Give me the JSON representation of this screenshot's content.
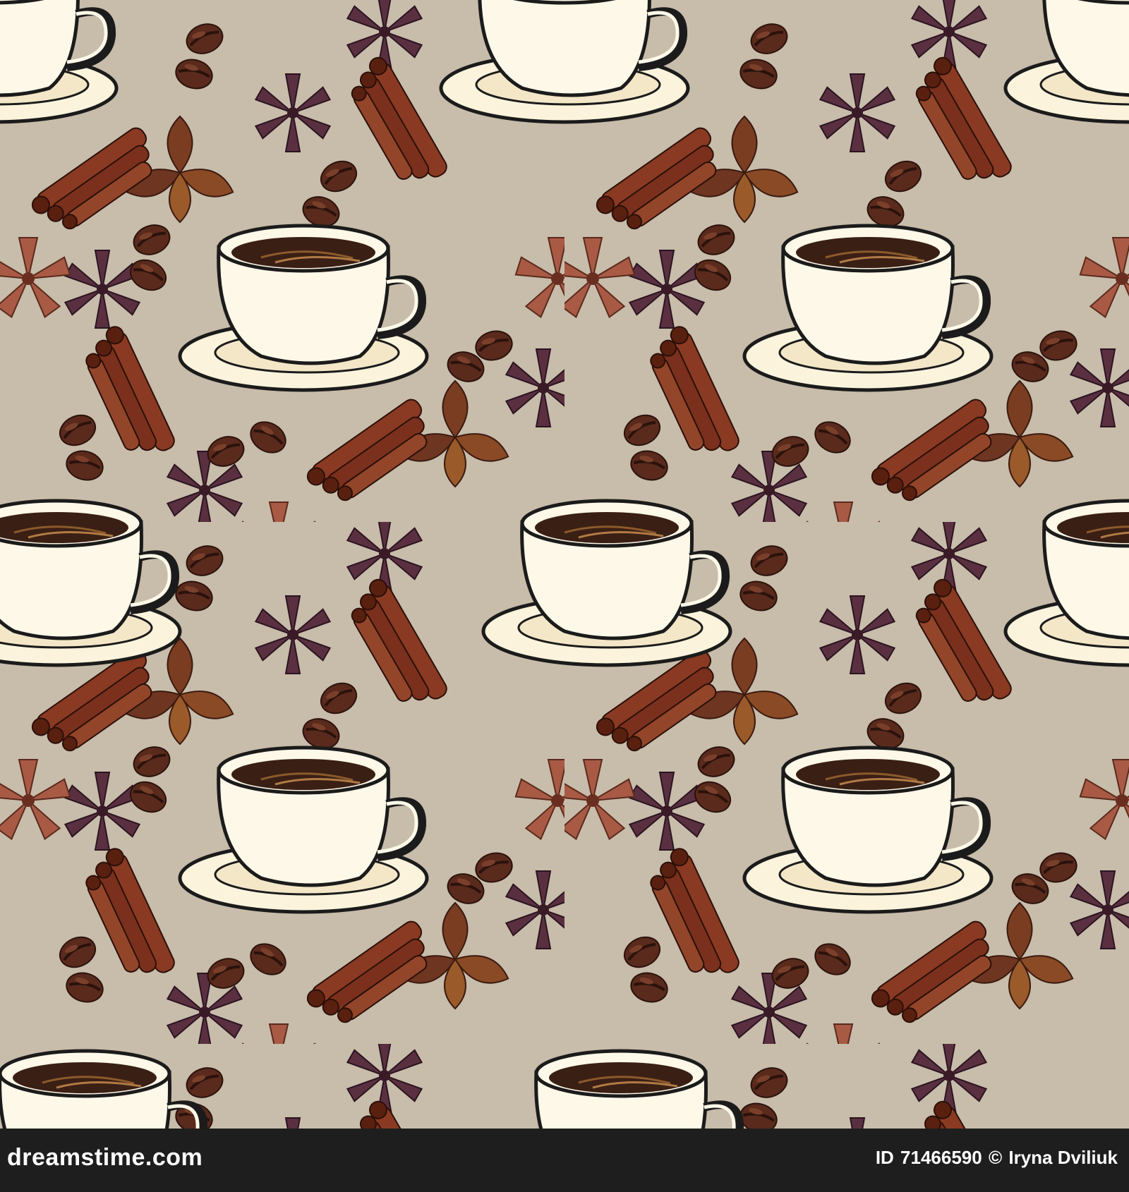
{
  "footer": {
    "brand": "dreamstime.com",
    "id_label": "ID",
    "id_number": "71466590",
    "copyright_symbol": "©",
    "author": "Iryna Dviliuk"
  },
  "pattern": {
    "background_color": "#c8bcaa",
    "cup_color": "#fbf3dc",
    "coffee_color": "#3a1f14",
    "cinnamon_color": "#8a3a22",
    "bean_color": "#5a2a1c",
    "star_anise_dark": "#5a3040",
    "star_anise_red": "#a85a45",
    "leaf_brown": "#7a3d22"
  }
}
